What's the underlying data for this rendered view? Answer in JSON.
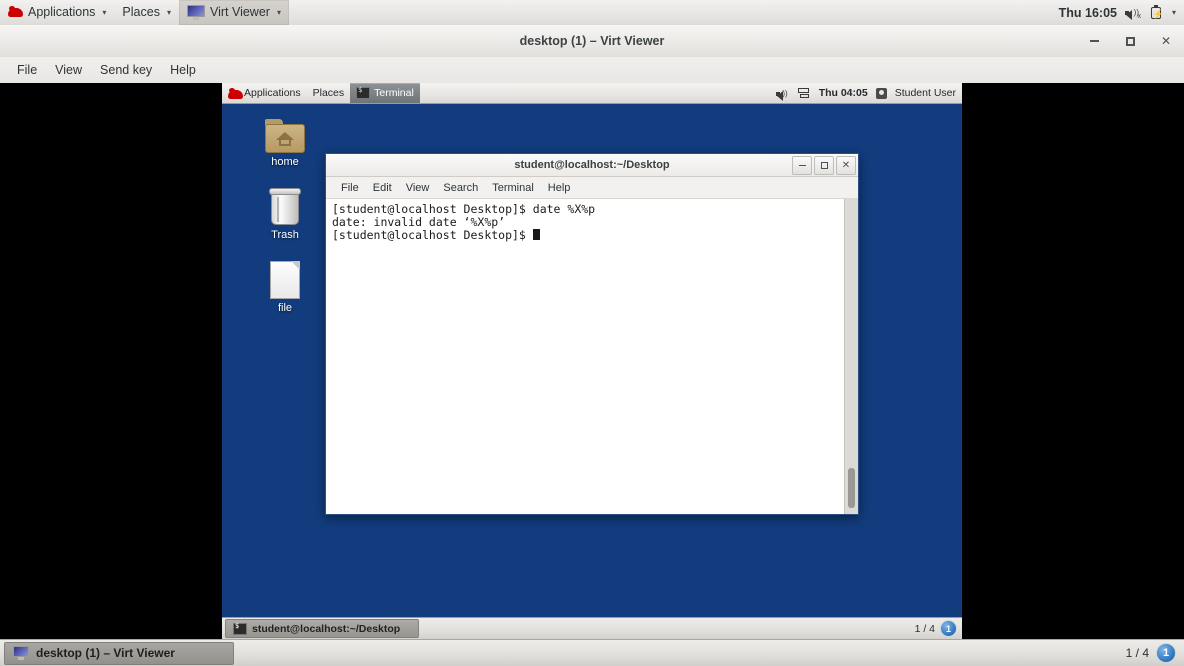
{
  "host_panel": {
    "menus": [
      {
        "label": "Applications",
        "icon": "red-hat-logo",
        "caret": "▾"
      },
      {
        "label": "Places",
        "caret": "▾"
      },
      {
        "label": "Virt Viewer",
        "icon": "monitor-icon",
        "caret": "▾",
        "active": true
      }
    ],
    "clock": "Thu 16:05",
    "icons": {
      "volume": "volume-muted-icon",
      "battery": "battery-icon",
      "caret": "▾"
    }
  },
  "virt_viewer": {
    "title": "desktop (1) – Virt Viewer",
    "window_buttons": {
      "minimize": "–",
      "maximize": "□",
      "close": "✕"
    },
    "menubar": [
      "File",
      "View",
      "Send key",
      "Help"
    ]
  },
  "guest": {
    "panel": {
      "menus": [
        {
          "label": "Applications",
          "icon": "red-hat-logo"
        },
        {
          "label": "Places"
        },
        {
          "label": "Terminal",
          "icon": "terminal-icon",
          "active": true
        }
      ],
      "clock": "Thu 04:05",
      "user": "Student User",
      "icons": {
        "volume": "volume-icon",
        "network": "network-icon",
        "user": "user-icon"
      }
    },
    "desktop_icons": [
      {
        "label": "home",
        "icon": "home-folder-icon"
      },
      {
        "label": "Trash",
        "icon": "trash-icon"
      },
      {
        "label": "file",
        "icon": "file-icon"
      }
    ],
    "terminal": {
      "title": "student@localhost:~/Desktop",
      "window_buttons": {
        "minimize": "–",
        "maximize": "□",
        "close": "✕"
      },
      "menubar": [
        "File",
        "Edit",
        "View",
        "Search",
        "Terminal",
        "Help"
      ],
      "lines": [
        "[student@localhost Desktop]$ date %X%p",
        "date: invalid date ‘%X%p’",
        "[student@localhost Desktop]$ "
      ]
    },
    "taskbar": {
      "window_button": "student@localhost:~/Desktop",
      "workspace": "1 / 4",
      "workspace_badge": "1"
    }
  },
  "host_taskbar": {
    "window_button": "desktop (1) – Virt Viewer",
    "workspace": "1 / 4",
    "workspace_badge": "1"
  },
  "colors": {
    "desktop_blue": "#123c7d",
    "panel_gray": "#e8e7e5",
    "letterbox": "#000000",
    "badge_blue": "#2a72b8"
  }
}
